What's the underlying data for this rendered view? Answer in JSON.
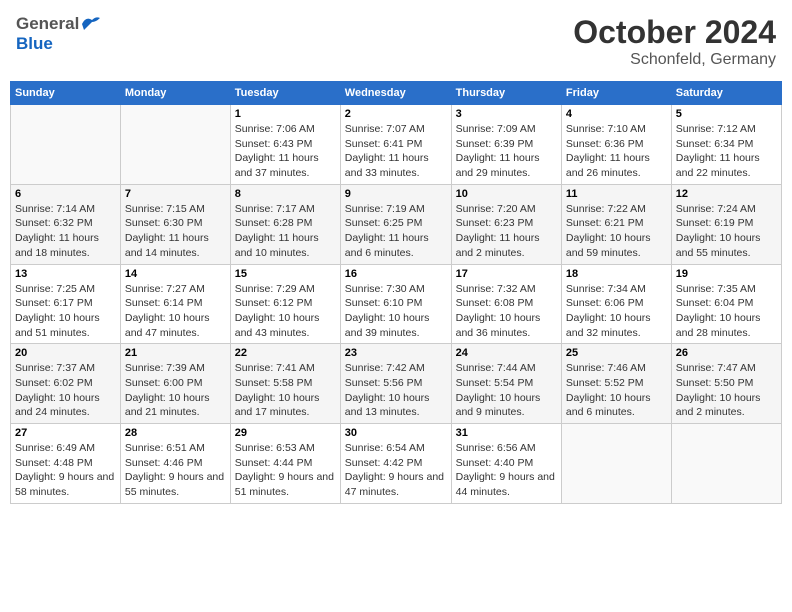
{
  "header": {
    "logo_general": "General",
    "logo_blue": "Blue",
    "month": "October 2024",
    "location": "Schonfeld, Germany"
  },
  "weekdays": [
    "Sunday",
    "Monday",
    "Tuesday",
    "Wednesday",
    "Thursday",
    "Friday",
    "Saturday"
  ],
  "weeks": [
    [
      {
        "day": "",
        "details": ""
      },
      {
        "day": "",
        "details": ""
      },
      {
        "day": "1",
        "details": "Sunrise: 7:06 AM\nSunset: 6:43 PM\nDaylight: 11 hours and 37 minutes."
      },
      {
        "day": "2",
        "details": "Sunrise: 7:07 AM\nSunset: 6:41 PM\nDaylight: 11 hours and 33 minutes."
      },
      {
        "day": "3",
        "details": "Sunrise: 7:09 AM\nSunset: 6:39 PM\nDaylight: 11 hours and 29 minutes."
      },
      {
        "day": "4",
        "details": "Sunrise: 7:10 AM\nSunset: 6:36 PM\nDaylight: 11 hours and 26 minutes."
      },
      {
        "day": "5",
        "details": "Sunrise: 7:12 AM\nSunset: 6:34 PM\nDaylight: 11 hours and 22 minutes."
      }
    ],
    [
      {
        "day": "6",
        "details": "Sunrise: 7:14 AM\nSunset: 6:32 PM\nDaylight: 11 hours and 18 minutes."
      },
      {
        "day": "7",
        "details": "Sunrise: 7:15 AM\nSunset: 6:30 PM\nDaylight: 11 hours and 14 minutes."
      },
      {
        "day": "8",
        "details": "Sunrise: 7:17 AM\nSunset: 6:28 PM\nDaylight: 11 hours and 10 minutes."
      },
      {
        "day": "9",
        "details": "Sunrise: 7:19 AM\nSunset: 6:25 PM\nDaylight: 11 hours and 6 minutes."
      },
      {
        "day": "10",
        "details": "Sunrise: 7:20 AM\nSunset: 6:23 PM\nDaylight: 11 hours and 2 minutes."
      },
      {
        "day": "11",
        "details": "Sunrise: 7:22 AM\nSunset: 6:21 PM\nDaylight: 10 hours and 59 minutes."
      },
      {
        "day": "12",
        "details": "Sunrise: 7:24 AM\nSunset: 6:19 PM\nDaylight: 10 hours and 55 minutes."
      }
    ],
    [
      {
        "day": "13",
        "details": "Sunrise: 7:25 AM\nSunset: 6:17 PM\nDaylight: 10 hours and 51 minutes."
      },
      {
        "day": "14",
        "details": "Sunrise: 7:27 AM\nSunset: 6:14 PM\nDaylight: 10 hours and 47 minutes."
      },
      {
        "day": "15",
        "details": "Sunrise: 7:29 AM\nSunset: 6:12 PM\nDaylight: 10 hours and 43 minutes."
      },
      {
        "day": "16",
        "details": "Sunrise: 7:30 AM\nSunset: 6:10 PM\nDaylight: 10 hours and 39 minutes."
      },
      {
        "day": "17",
        "details": "Sunrise: 7:32 AM\nSunset: 6:08 PM\nDaylight: 10 hours and 36 minutes."
      },
      {
        "day": "18",
        "details": "Sunrise: 7:34 AM\nSunset: 6:06 PM\nDaylight: 10 hours and 32 minutes."
      },
      {
        "day": "19",
        "details": "Sunrise: 7:35 AM\nSunset: 6:04 PM\nDaylight: 10 hours and 28 minutes."
      }
    ],
    [
      {
        "day": "20",
        "details": "Sunrise: 7:37 AM\nSunset: 6:02 PM\nDaylight: 10 hours and 24 minutes."
      },
      {
        "day": "21",
        "details": "Sunrise: 7:39 AM\nSunset: 6:00 PM\nDaylight: 10 hours and 21 minutes."
      },
      {
        "day": "22",
        "details": "Sunrise: 7:41 AM\nSunset: 5:58 PM\nDaylight: 10 hours and 17 minutes."
      },
      {
        "day": "23",
        "details": "Sunrise: 7:42 AM\nSunset: 5:56 PM\nDaylight: 10 hours and 13 minutes."
      },
      {
        "day": "24",
        "details": "Sunrise: 7:44 AM\nSunset: 5:54 PM\nDaylight: 10 hours and 9 minutes."
      },
      {
        "day": "25",
        "details": "Sunrise: 7:46 AM\nSunset: 5:52 PM\nDaylight: 10 hours and 6 minutes."
      },
      {
        "day": "26",
        "details": "Sunrise: 7:47 AM\nSunset: 5:50 PM\nDaylight: 10 hours and 2 minutes."
      }
    ],
    [
      {
        "day": "27",
        "details": "Sunrise: 6:49 AM\nSunset: 4:48 PM\nDaylight: 9 hours and 58 minutes."
      },
      {
        "day": "28",
        "details": "Sunrise: 6:51 AM\nSunset: 4:46 PM\nDaylight: 9 hours and 55 minutes."
      },
      {
        "day": "29",
        "details": "Sunrise: 6:53 AM\nSunset: 4:44 PM\nDaylight: 9 hours and 51 minutes."
      },
      {
        "day": "30",
        "details": "Sunrise: 6:54 AM\nSunset: 4:42 PM\nDaylight: 9 hours and 47 minutes."
      },
      {
        "day": "31",
        "details": "Sunrise: 6:56 AM\nSunset: 4:40 PM\nDaylight: 9 hours and 44 minutes."
      },
      {
        "day": "",
        "details": ""
      },
      {
        "day": "",
        "details": ""
      }
    ]
  ]
}
